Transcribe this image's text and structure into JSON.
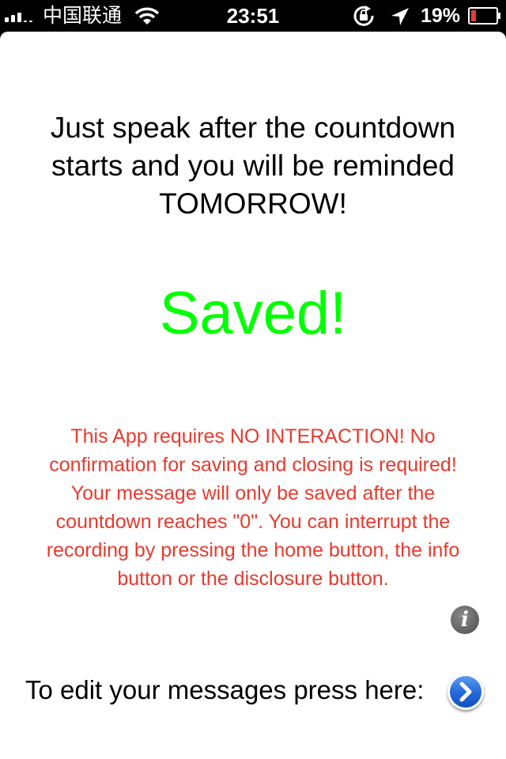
{
  "status_bar": {
    "carrier": "中国联通",
    "time": "23:51",
    "battery_percent": "19%",
    "battery_level": 0.19,
    "icons": [
      "signal-icon",
      "wifi-icon",
      "rotation-lock-icon",
      "location-icon",
      "battery-icon"
    ],
    "battery_color": "#e53b2f"
  },
  "main": {
    "headline": "Just speak after the countdown starts and you will be reminded TOMORROW!",
    "saved_label": "Saved!",
    "notice": "This App requires  NO INTERACTION!  No confirmation for saving and closing  is required! Your message will only be saved after the countdown reaches \"0\". You can interrupt the recording by pressing the home button, the info button or the disclosure button.",
    "info_button_glyph": "i",
    "edit_label": "To edit your messages press here:"
  },
  "colors": {
    "saved_green": "#00ff00",
    "notice_red": "#e83a2e",
    "disclosure_blue": "#2267d8"
  }
}
